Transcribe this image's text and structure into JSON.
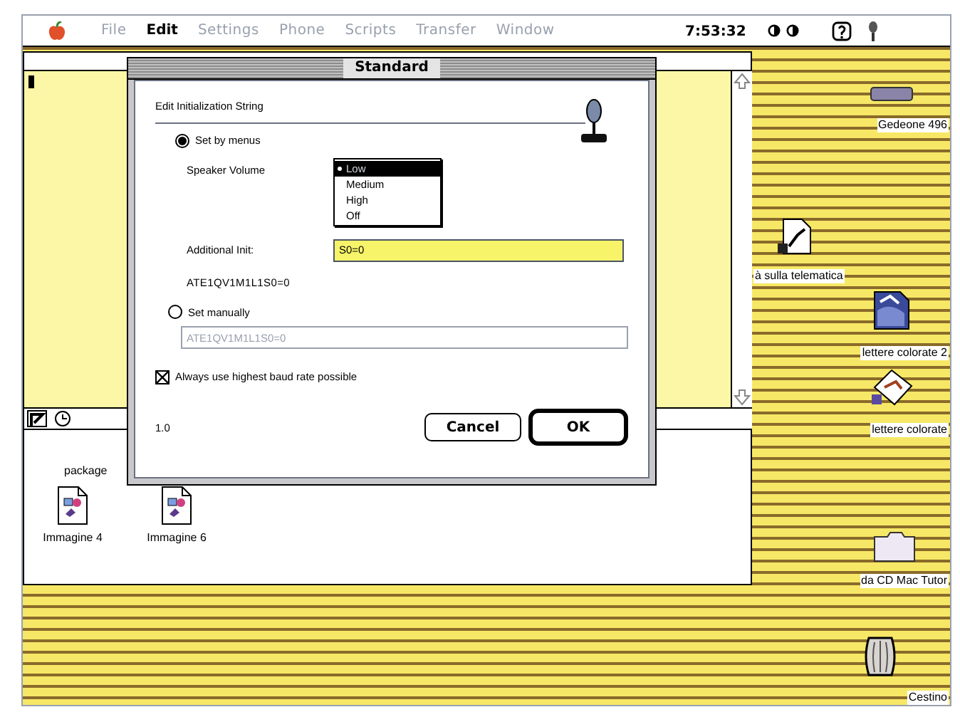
{
  "menu_bar": {
    "items": [
      {
        "label": "File",
        "disabled": true
      },
      {
        "label": "Edit",
        "disabled": false
      },
      {
        "label": "Settings",
        "disabled": true
      },
      {
        "label": "Phone",
        "disabled": true
      },
      {
        "label": "Scripts",
        "disabled": true
      },
      {
        "label": "Transfer",
        "disabled": true
      },
      {
        "label": "Window",
        "disabled": true
      }
    ],
    "clock": "7:53:32"
  },
  "file_window": {
    "label": "package",
    "files": [
      {
        "name": "Immagine 4"
      },
      {
        "name": "Immagine 6"
      }
    ]
  },
  "dialog": {
    "title": "Standard",
    "heading": "Edit Initialization String",
    "options": [
      {
        "label": "Set by menus",
        "selected": true
      },
      {
        "label": "Set manually",
        "selected": false
      }
    ],
    "speaker_volume": {
      "label": "Speaker Volume",
      "items": [
        {
          "label": "Low",
          "selected": true
        },
        {
          "label": "Medium",
          "selected": false
        },
        {
          "label": "High",
          "selected": false
        },
        {
          "label": "Off",
          "selected": false
        }
      ]
    },
    "additional_init": {
      "label": "Additional Init:",
      "value": "S0=0"
    },
    "computed_string": "ATE1QV1M1L1S0=0",
    "manual_field": {
      "value": "ATE1QV1M1L1S0=0",
      "disabled": true
    },
    "checkbox": {
      "label": "Always use highest baud rate possible",
      "checked": true
    },
    "version": "1.0",
    "buttons": [
      {
        "label": "Cancel",
        "default": false
      },
      {
        "label": "OK",
        "default": true
      }
    ]
  },
  "desktop_icons": [
    {
      "label": "Gedeone 496",
      "kind": "drive"
    },
    {
      "label": "à sulla telematica",
      "kind": "document"
    },
    {
      "label": "lettere colorate 2",
      "kind": "picture_doc"
    },
    {
      "label": "lettere colorate",
      "kind": "alias_doc"
    },
    {
      "label": "da CD Mac Tutor",
      "kind": "folder"
    },
    {
      "label": "Cestino",
      "kind": "trash"
    }
  ]
}
